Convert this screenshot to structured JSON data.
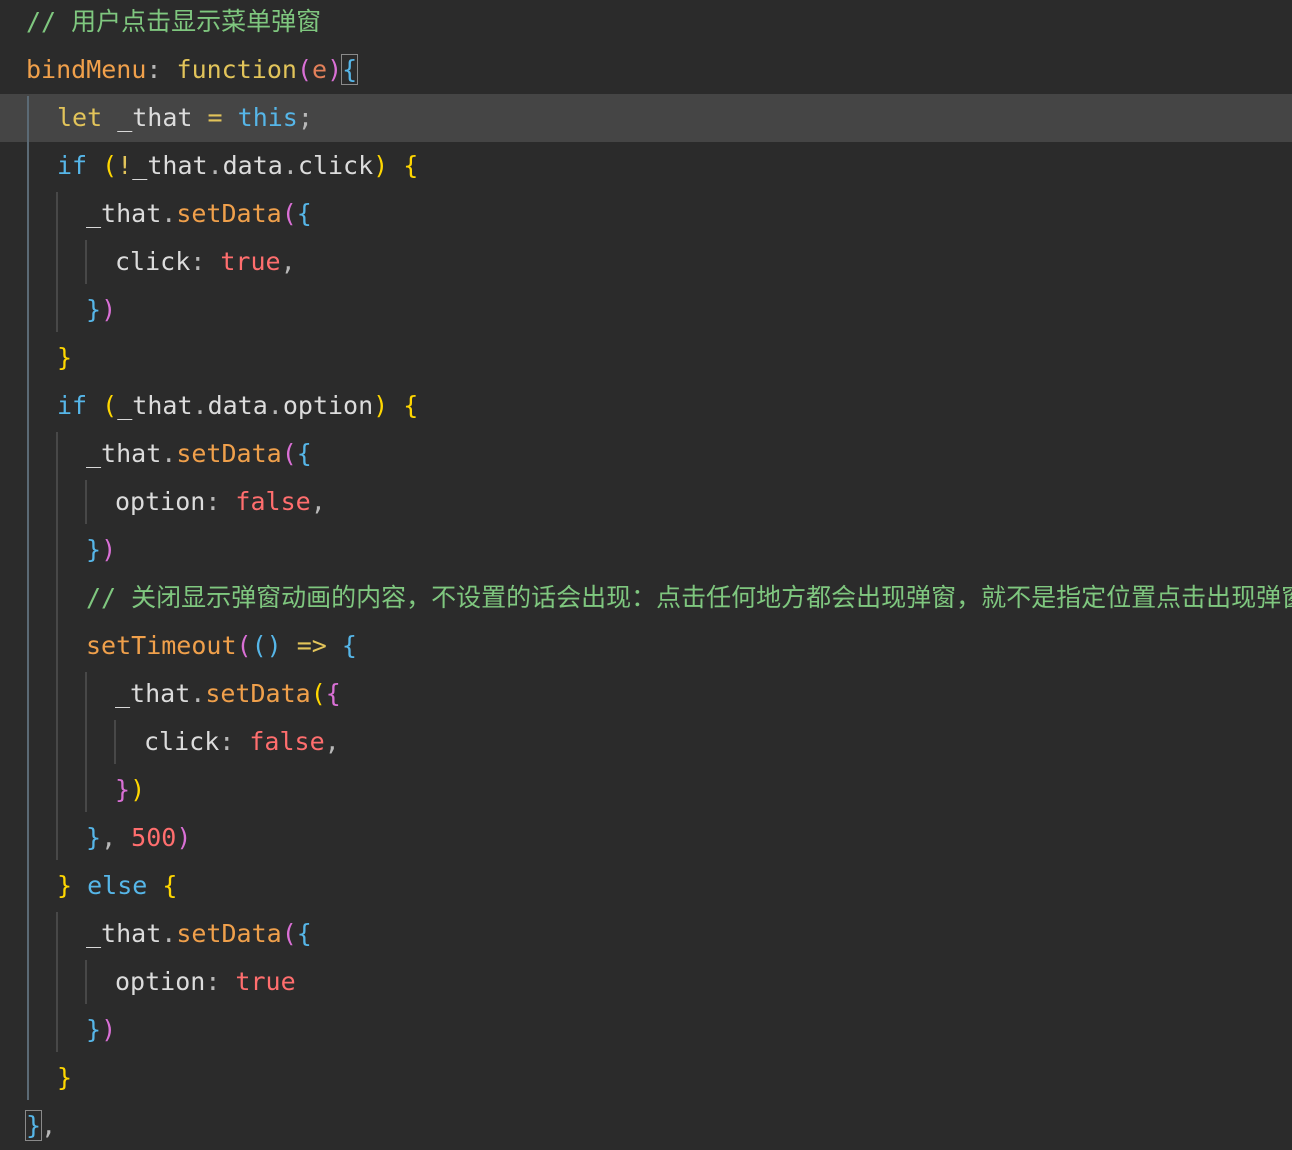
{
  "editor": {
    "colors": {
      "background": "#2b2b2b",
      "current_line": "#454545",
      "comment": "#7fc77f",
      "keyword": "#e2c45a",
      "storage": "#56b6e8",
      "function_name": "#f0a04b",
      "boolean": "#ff6e6e",
      "bracket_level_1": "#ffd700",
      "bracket_level_2": "#da70d6",
      "bracket_level_3": "#56b6e8"
    },
    "current_line_index": 2,
    "lines": [
      {
        "indent": 0,
        "tokens": [
          {
            "t": "comment",
            "v": "// 用户点击显示菜单弹窗"
          }
        ]
      },
      {
        "indent": 0,
        "tokens": [
          {
            "t": "func",
            "v": "bindMenu"
          },
          {
            "t": "punct",
            "v": ": "
          },
          {
            "t": "keyword",
            "v": "function"
          },
          {
            "t": "b2",
            "v": "("
          },
          {
            "t": "param",
            "v": "e"
          },
          {
            "t": "b2",
            "v": ")"
          },
          {
            "t": "b3",
            "v": "{",
            "box": true
          }
        ]
      },
      {
        "indent": 1,
        "tokens": [
          {
            "t": "keyword",
            "v": "let"
          },
          {
            "t": "ident",
            "v": " _that "
          },
          {
            "t": "op",
            "v": "="
          },
          {
            "t": "ident",
            "v": " "
          },
          {
            "t": "storage",
            "v": "this"
          },
          {
            "t": "punct",
            "v": ";"
          }
        ]
      },
      {
        "indent": 1,
        "tokens": [
          {
            "t": "storage",
            "v": "if"
          },
          {
            "t": "ident",
            "v": " "
          },
          {
            "t": "b1",
            "v": "("
          },
          {
            "t": "op",
            "v": "!"
          },
          {
            "t": "ident",
            "v": "_that"
          },
          {
            "t": "punct",
            "v": "."
          },
          {
            "t": "ident",
            "v": "data"
          },
          {
            "t": "punct",
            "v": "."
          },
          {
            "t": "ident",
            "v": "click"
          },
          {
            "t": "b1",
            "v": ")"
          },
          {
            "t": "ident",
            "v": " "
          },
          {
            "t": "b1",
            "v": "{"
          }
        ]
      },
      {
        "indent": 2,
        "tokens": [
          {
            "t": "ident",
            "v": "_that"
          },
          {
            "t": "punct",
            "v": "."
          },
          {
            "t": "func",
            "v": "setData"
          },
          {
            "t": "b2",
            "v": "("
          },
          {
            "t": "b3",
            "v": "{"
          }
        ]
      },
      {
        "indent": 3,
        "tokens": [
          {
            "t": "prop",
            "v": "click"
          },
          {
            "t": "punct",
            "v": ": "
          },
          {
            "t": "bool",
            "v": "true"
          },
          {
            "t": "punct",
            "v": ","
          }
        ]
      },
      {
        "indent": 2,
        "tokens": [
          {
            "t": "b3",
            "v": "}"
          },
          {
            "t": "b2",
            "v": ")"
          }
        ]
      },
      {
        "indent": 1,
        "tokens": [
          {
            "t": "b1",
            "v": "}"
          }
        ]
      },
      {
        "indent": 1,
        "tokens": [
          {
            "t": "storage",
            "v": "if"
          },
          {
            "t": "ident",
            "v": " "
          },
          {
            "t": "b1",
            "v": "("
          },
          {
            "t": "ident",
            "v": "_that"
          },
          {
            "t": "punct",
            "v": "."
          },
          {
            "t": "ident",
            "v": "data"
          },
          {
            "t": "punct",
            "v": "."
          },
          {
            "t": "ident",
            "v": "option"
          },
          {
            "t": "b1",
            "v": ")"
          },
          {
            "t": "ident",
            "v": " "
          },
          {
            "t": "b1",
            "v": "{"
          }
        ]
      },
      {
        "indent": 2,
        "tokens": [
          {
            "t": "ident",
            "v": "_that"
          },
          {
            "t": "punct",
            "v": "."
          },
          {
            "t": "func",
            "v": "setData"
          },
          {
            "t": "b2",
            "v": "("
          },
          {
            "t": "b3",
            "v": "{"
          }
        ]
      },
      {
        "indent": 3,
        "tokens": [
          {
            "t": "prop",
            "v": "option"
          },
          {
            "t": "punct",
            "v": ": "
          },
          {
            "t": "bool",
            "v": "false"
          },
          {
            "t": "punct",
            "v": ","
          }
        ]
      },
      {
        "indent": 2,
        "tokens": [
          {
            "t": "b3",
            "v": "}"
          },
          {
            "t": "b2",
            "v": ")"
          }
        ]
      },
      {
        "indent": 2,
        "tokens": [
          {
            "t": "comment",
            "v": "// 关闭显示弹窗动画的内容，不设置的话会出现：点击任何地方都会出现弹窗，就不是指定位置点击出现弹窗了"
          }
        ]
      },
      {
        "indent": 2,
        "tokens": [
          {
            "t": "func",
            "v": "setTimeout"
          },
          {
            "t": "b2",
            "v": "("
          },
          {
            "t": "b3",
            "v": "()"
          },
          {
            "t": "ident",
            "v": " "
          },
          {
            "t": "op",
            "v": "=>"
          },
          {
            "t": "ident",
            "v": " "
          },
          {
            "t": "b3",
            "v": "{"
          }
        ]
      },
      {
        "indent": 3,
        "tokens": [
          {
            "t": "ident",
            "v": "_that"
          },
          {
            "t": "punct",
            "v": "."
          },
          {
            "t": "func",
            "v": "setData"
          },
          {
            "t": "b1",
            "v": "("
          },
          {
            "t": "b2",
            "v": "{"
          }
        ]
      },
      {
        "indent": 4,
        "tokens": [
          {
            "t": "prop",
            "v": "click"
          },
          {
            "t": "punct",
            "v": ": "
          },
          {
            "t": "bool",
            "v": "false"
          },
          {
            "t": "punct",
            "v": ","
          }
        ]
      },
      {
        "indent": 3,
        "tokens": [
          {
            "t": "b2",
            "v": "}"
          },
          {
            "t": "b1",
            "v": ")"
          }
        ]
      },
      {
        "indent": 2,
        "tokens": [
          {
            "t": "b3",
            "v": "}"
          },
          {
            "t": "punct",
            "v": ", "
          },
          {
            "t": "num",
            "v": "500"
          },
          {
            "t": "b2",
            "v": ")"
          }
        ]
      },
      {
        "indent": 1,
        "tokens": [
          {
            "t": "b1",
            "v": "}"
          },
          {
            "t": "ident",
            "v": " "
          },
          {
            "t": "storage",
            "v": "else"
          },
          {
            "t": "ident",
            "v": " "
          },
          {
            "t": "b1",
            "v": "{"
          }
        ]
      },
      {
        "indent": 2,
        "tokens": [
          {
            "t": "ident",
            "v": "_that"
          },
          {
            "t": "punct",
            "v": "."
          },
          {
            "t": "func",
            "v": "setData"
          },
          {
            "t": "b2",
            "v": "("
          },
          {
            "t": "b3",
            "v": "{"
          }
        ]
      },
      {
        "indent": 3,
        "tokens": [
          {
            "t": "prop",
            "v": "option"
          },
          {
            "t": "punct",
            "v": ": "
          },
          {
            "t": "bool",
            "v": "true"
          }
        ]
      },
      {
        "indent": 2,
        "tokens": [
          {
            "t": "b3",
            "v": "}"
          },
          {
            "t": "b2",
            "v": ")"
          }
        ]
      },
      {
        "indent": 1,
        "tokens": [
          {
            "t": "b1",
            "v": "}"
          }
        ]
      },
      {
        "indent": 0,
        "tokens": [
          {
            "t": "b3",
            "v": "}",
            "box": true
          },
          {
            "t": "punct",
            "v": ","
          }
        ]
      }
    ]
  }
}
